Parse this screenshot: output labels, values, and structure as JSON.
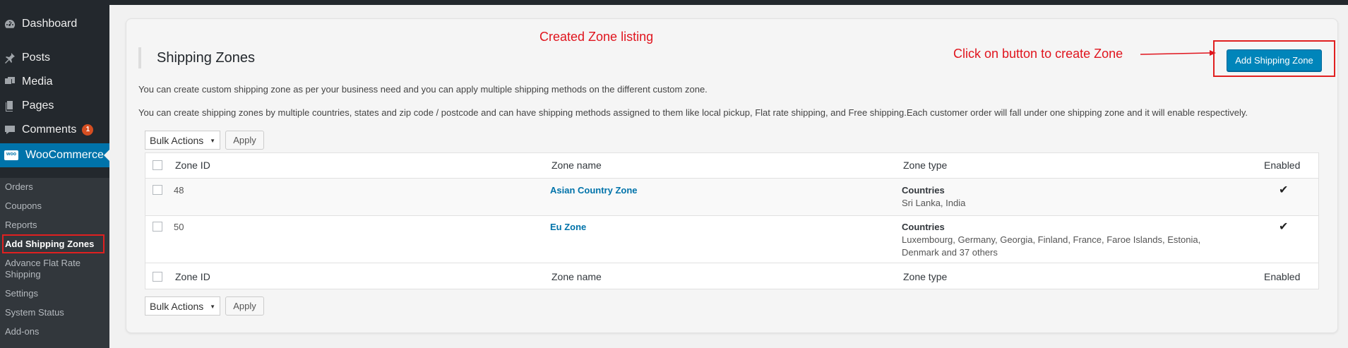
{
  "sidebar": {
    "items": [
      {
        "label": "Dashboard",
        "icon": "dashboard-icon"
      },
      {
        "label": "Posts",
        "icon": "pin-icon"
      },
      {
        "label": "Media",
        "icon": "media-icon"
      },
      {
        "label": "Pages",
        "icon": "pages-icon"
      },
      {
        "label": "Comments",
        "icon": "comment-icon",
        "badge": "1"
      },
      {
        "label": "WooCommerce",
        "icon": "woo-icon"
      }
    ],
    "submenu": [
      "Orders",
      "Coupons",
      "Reports",
      "Add Shipping Zones",
      "Advance Flat Rate Shipping",
      "Settings",
      "System Status",
      "Add-ons"
    ],
    "woo_icon_text": "woo"
  },
  "page": {
    "title": "Shipping Zones",
    "add_button": "Add Shipping Zone",
    "desc1": "You can create custom shipping zone as per your business need and you can apply multiple shipping methods on the different custom zone.",
    "desc2": "You can create shipping zones by multiple countries, states and zip code / postcode and can have shipping methods assigned to them like local pickup, Flat rate shipping, and Free shipping.Each customer order will fall under one shipping zone and it will enable respectively."
  },
  "annotations": {
    "listing": "Created Zone listing",
    "button": "Click on button to create Zone",
    "color": "#e0151e"
  },
  "bulk": {
    "label": "Bulk Actions",
    "apply": "Apply"
  },
  "table": {
    "headers": [
      "Zone ID",
      "Zone name",
      "Zone type",
      "Enabled"
    ],
    "rows": [
      {
        "id": "48",
        "name": "Asian Country Zone",
        "type": "Countries",
        "detail1": "Sri Lanka, India",
        "detail2": "",
        "enabled": true
      },
      {
        "id": "50",
        "name": "Eu Zone",
        "type": "Countries",
        "detail1": "Luxembourg, Germany, Georgia, Finland, France, Faroe Islands, Estonia,",
        "detail2": "Denmark and 37 others",
        "enabled": true
      }
    ]
  },
  "colors": {
    "sidebar": "#23282d",
    "accent": "#0073aa",
    "button": "#0085ba"
  }
}
